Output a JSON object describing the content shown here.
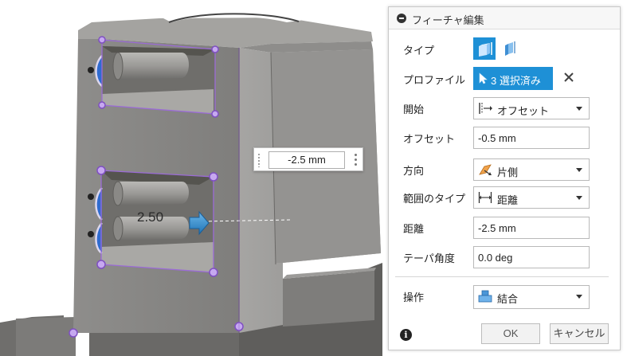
{
  "viewport": {
    "floating_value": "-2.5 mm",
    "dimension_label": "2.50"
  },
  "panel": {
    "title": "フィーチャ編集",
    "rows": {
      "type": {
        "label": "タイプ",
        "icons": [
          "solid-extrude-icon",
          "thin-extrude-icon"
        ]
      },
      "profile": {
        "label": "プロファイル",
        "button": "3 選択済み"
      },
      "start": {
        "label": "開始",
        "value": "オフセット",
        "icon": "offset-start-icon"
      },
      "offset": {
        "label": "オフセット",
        "value": "-0.5 mm"
      },
      "direction": {
        "label": "方向",
        "value": "片側",
        "icon": "one-side-icon"
      },
      "extent_type": {
        "label": "範囲のタイプ",
        "value": "距離",
        "icon": "distance-icon"
      },
      "distance": {
        "label": "距離",
        "value": "-2.5 mm"
      },
      "taper_angle": {
        "label": "テーパ角度",
        "value": "0.0 deg"
      },
      "operation": {
        "label": "操作",
        "value": "結合",
        "icon": "join-icon"
      }
    },
    "footer": {
      "ok": "OK",
      "cancel": "キャンセル"
    }
  },
  "colors": {
    "accent": "#1e90d6",
    "body_face": "#8c8b89",
    "sketch_line": "#9b6bd6",
    "arrow": "#3a8fd0"
  }
}
